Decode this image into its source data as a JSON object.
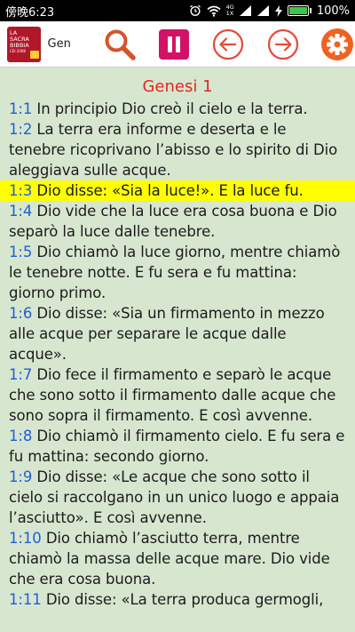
{
  "status_bar": {
    "time": "傍晚6:23",
    "network_top": "4G",
    "network_bottom": "1X",
    "battery": "100%",
    "battery_level": 1.0,
    "icons": [
      "alarm-icon",
      "wifi-icon",
      "signal-icon",
      "signal-icon",
      "charging-icon",
      "battery-icon"
    ]
  },
  "toolbar": {
    "logo_lines": [
      "LA",
      "SACRA",
      "BIBBIA",
      "CEI 2008"
    ],
    "book_name": "Gen",
    "buttons": [
      {
        "icon": "search-icon",
        "color": "#d5532a"
      },
      {
        "icon": "pause-icon",
        "color": "#d21266"
      },
      {
        "icon": "arrow-left-icon",
        "color": "#e64a3a"
      },
      {
        "icon": "arrow-right-icon",
        "color": "#e64a3a"
      },
      {
        "icon": "gear-icon",
        "color": "#f0621f"
      }
    ]
  },
  "colors": {
    "background": "#d7e6cf",
    "chapter_title": "#e5251f",
    "verse_ref": "#1e5ed8",
    "highlight": "#ffff00"
  },
  "reader": {
    "chapter_title": "Genesi 1",
    "verses": [
      {
        "ref": "1:1",
        "text": "In principio Dio creò il cielo e la terra.",
        "highlighted": false
      },
      {
        "ref": "1:2",
        "text": "La terra era informe e deserta e le tenebre ricoprivano l’abisso e lo spirito di Dio aleggiava sulle acque.",
        "highlighted": false
      },
      {
        "ref": "1:3",
        "text": "Dio disse: «Sia la luce!». E la luce fu.",
        "highlighted": true
      },
      {
        "ref": "1:4",
        "text": "Dio vide che la luce era cosa buona e Dio separò la luce dalle tenebre.",
        "highlighted": false
      },
      {
        "ref": "1:5",
        "text": "Dio chiamò la luce giorno, mentre chiamò le tenebre notte. E fu sera e fu mattina: giorno primo.",
        "highlighted": false
      },
      {
        "ref": "1:6",
        "text": "Dio disse: «Sia un firmamento in mezzo alle acque per separare le acque dalle acque».",
        "highlighted": false
      },
      {
        "ref": "1:7",
        "text": "Dio fece il firmamento e separò le acque che sono sotto il firmamento dalle acque che sono sopra il firmamento. E così avvenne.",
        "highlighted": false
      },
      {
        "ref": "1:8",
        "text": "Dio chiamò il firmamento cielo. E fu sera e fu mattina: secondo giorno.",
        "highlighted": false
      },
      {
        "ref": "1:9",
        "text": "Dio disse: «Le acque che sono sotto il cielo si raccolgano in un unico luogo e appaia l’asciutto». E così avvenne.",
        "highlighted": false
      },
      {
        "ref": "1:10",
        "text": "Dio chiamò l’asciutto terra, mentre chiamò la massa delle acque mare. Dio vide che era cosa buona.",
        "highlighted": false
      },
      {
        "ref": "1:11",
        "text": "Dio disse: «La terra produca germogli,",
        "highlighted": false
      }
    ]
  }
}
